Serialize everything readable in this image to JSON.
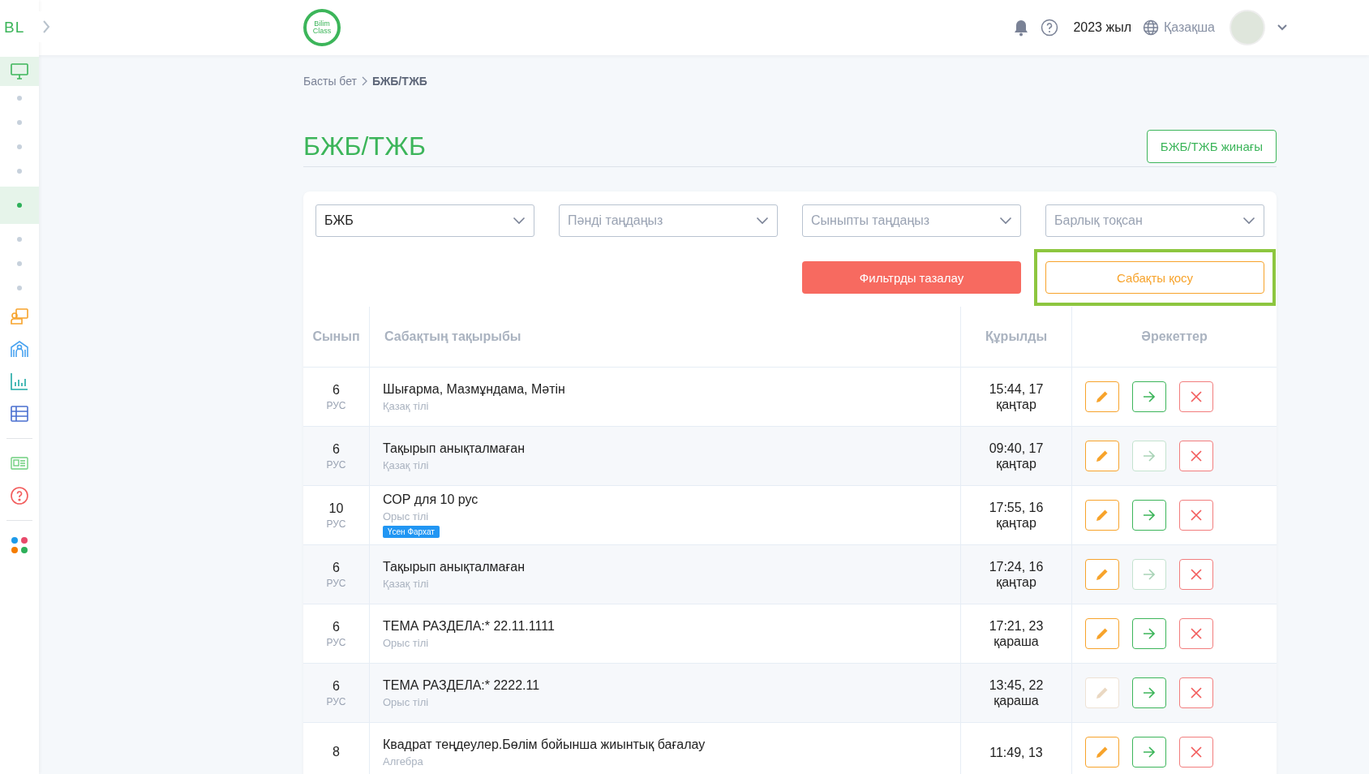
{
  "sidebar": {
    "logo": "BL",
    "items": [
      {
        "kind": "monitor",
        "selected": true
      },
      {
        "kind": "dot",
        "selected": false
      },
      {
        "kind": "dot",
        "selected": false
      },
      {
        "kind": "dot",
        "selected": false
      },
      {
        "kind": "dot",
        "selected": false
      },
      {
        "kind": "dot",
        "selected": true
      },
      {
        "kind": "dot",
        "selected": false
      },
      {
        "kind": "dot",
        "selected": false
      },
      {
        "kind": "dot",
        "selected": false
      },
      {
        "kind": "teacher",
        "selected": false
      },
      {
        "kind": "school",
        "selected": false
      },
      {
        "kind": "chart",
        "selected": false
      },
      {
        "kind": "table",
        "selected": false
      },
      {
        "kind": "divider"
      },
      {
        "kind": "newspaper",
        "selected": false
      },
      {
        "kind": "help",
        "selected": false
      },
      {
        "kind": "divider"
      },
      {
        "kind": "apps",
        "selected": false
      }
    ]
  },
  "topbar": {
    "logo": "Bilim Class",
    "year": "2023 жыл",
    "language": "Қазақша"
  },
  "breadcrumb": [
    "Басты бет",
    "БЖБ/ТЖБ"
  ],
  "title": "БЖБ/ТЖБ",
  "collection_button": "БЖБ/ТЖБ жинағы",
  "filters": [
    {
      "value": "БЖБ"
    },
    {
      "placeholder": "Пәнді таңдаңыз"
    },
    {
      "placeholder": "Сыныпты таңдаңыз"
    },
    {
      "placeholder": "Барлық тоқсан"
    }
  ],
  "clear_button": "Фильтрды тазалау",
  "add_button": {
    "label": "Сабақты қосу",
    "highlighted": true
  },
  "table": {
    "columns": [
      "Сынып",
      "Сабақтың тақырыбы",
      "Құрылды",
      "Әрекеттер"
    ],
    "rows": [
      {
        "class": "6",
        "class_note": "РУС",
        "title": "Шығарма, Мазмұндама, Мәтін",
        "subject": "Қазақ тілі",
        "created": "15:44, 17 қаңтар",
        "edit_disabled": false,
        "open_disabled": false
      },
      {
        "class": "6",
        "class_note": "РУС",
        "title": "Тақырып анықталмаған",
        "subject": "Қазақ тілі",
        "created": "09:40, 17 қаңтар",
        "edit_disabled": false,
        "open_disabled": true
      },
      {
        "class": "10",
        "class_note": "РУС",
        "title": "СОР для 10 рус",
        "subject": "Орыс тілі",
        "tag": "Үсен Фархат",
        "created": "17:55, 16 қаңтар",
        "edit_disabled": false,
        "open_disabled": false
      },
      {
        "class": "6",
        "class_note": "РУС",
        "title": "Тақырып анықталмаған",
        "subject": "Қазақ тілі",
        "created": "17:24, 16 қаңтар",
        "edit_disabled": false,
        "open_disabled": true
      },
      {
        "class": "6",
        "class_note": "РУС",
        "title": "ТЕМА РАЗДЕЛА:* 22.11.1111",
        "subject": "Орыс тілі",
        "created": "17:21, 23 қараша",
        "edit_disabled": false,
        "open_disabled": false
      },
      {
        "class": "6",
        "class_note": "РУС",
        "title": "ТЕМА РАЗДЕЛА:* 2222.11",
        "subject": "Орыс тілі",
        "created": "13:45, 22 қараша",
        "edit_disabled": true,
        "open_disabled": false
      },
      {
        "class": "8",
        "title": "Квадрат теңдеулер.Бөлім бойынша жиынтық бағалау",
        "subject": "Алгебра",
        "created": "11:49, 13",
        "edit_disabled": false,
        "open_disabled": false
      }
    ]
  }
}
